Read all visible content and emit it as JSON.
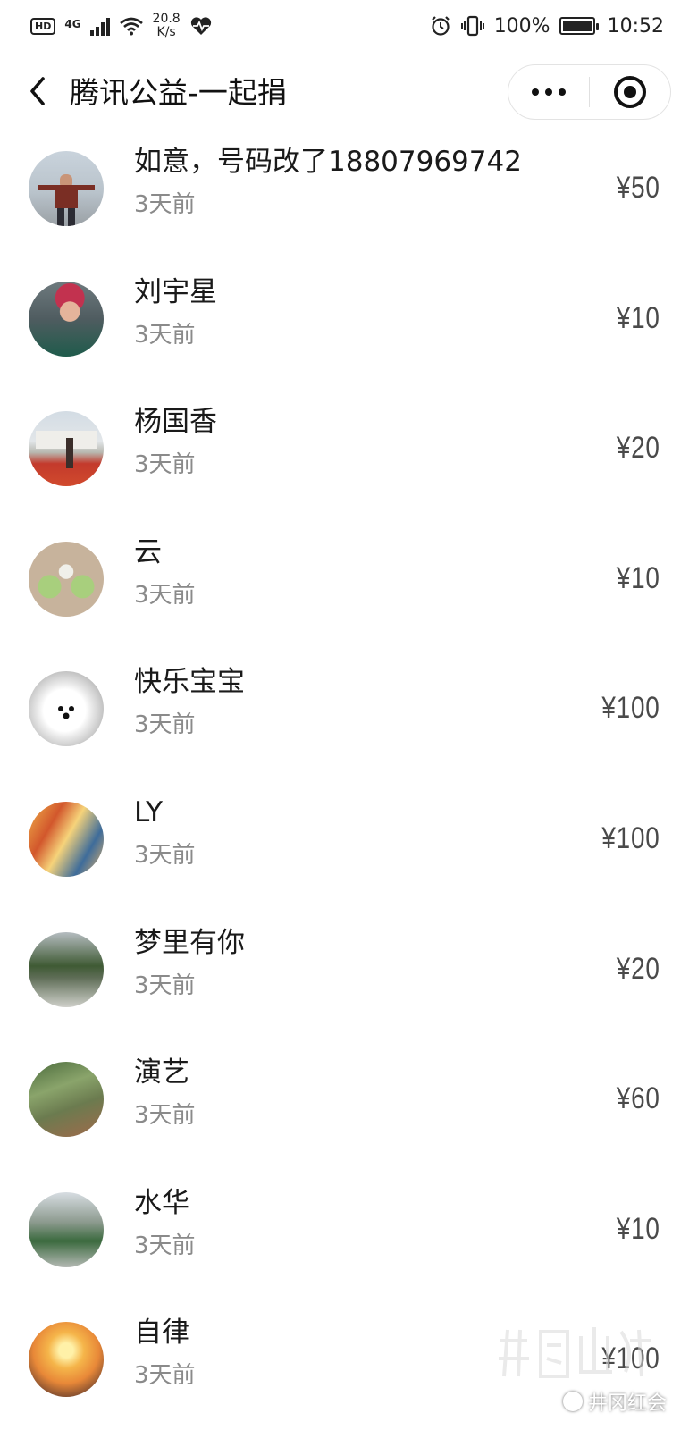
{
  "status_bar": {
    "left_badge": "HD",
    "network": "4G",
    "speed_value": "20.8",
    "speed_unit": "K/s",
    "battery": "100%",
    "time": "10:52"
  },
  "nav": {
    "title": "腾讯公益-一起捐"
  },
  "donations": [
    {
      "name": "如意，号码改了18807969742",
      "time": "3天前",
      "amount": "¥50"
    },
    {
      "name": "刘宇星",
      "time": "3天前",
      "amount": "¥10"
    },
    {
      "name": "杨国香",
      "time": "3天前",
      "amount": "¥20"
    },
    {
      "name": "云",
      "time": "3天前",
      "amount": "¥10"
    },
    {
      "name": "快乐宝宝",
      "time": "3天前",
      "amount": "¥100"
    },
    {
      "name": "LY",
      "time": "3天前",
      "amount": "¥100"
    },
    {
      "name": "梦里有你",
      "time": "3天前",
      "amount": "¥20"
    },
    {
      "name": "演艺",
      "time": "3天前",
      "amount": "¥60"
    },
    {
      "name": "水华",
      "time": "3天前",
      "amount": "¥10"
    },
    {
      "name": "自律",
      "time": "3天前",
      "amount": "¥100"
    }
  ],
  "watermark": {
    "account": "井冈红会"
  }
}
